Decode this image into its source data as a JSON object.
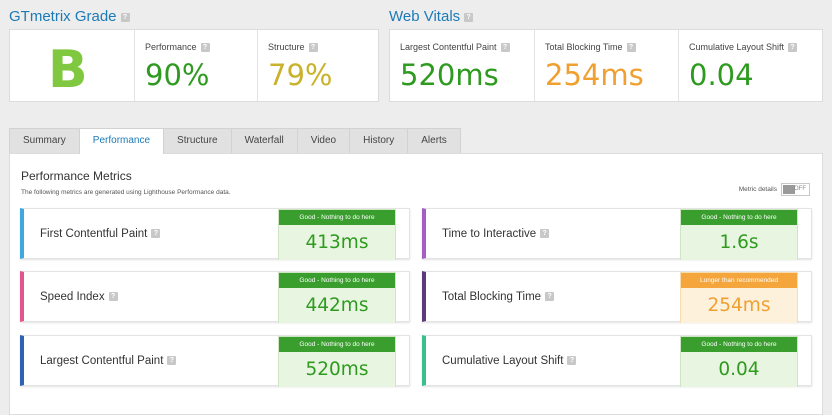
{
  "grade_section": {
    "title": "GTmetrix Grade",
    "grade": "B",
    "performance": {
      "label": "Performance",
      "value": "90%"
    },
    "structure": {
      "label": "Structure",
      "value": "79%"
    }
  },
  "vitals_section": {
    "title": "Web Vitals",
    "lcp": {
      "label": "Largest Contentful Paint",
      "value": "520ms"
    },
    "tbt": {
      "label": "Total Blocking Time",
      "value": "254ms"
    },
    "cls": {
      "label": "Cumulative Layout Shift",
      "value": "0.04"
    }
  },
  "help_glyph": "?",
  "tabs": [
    "Summary",
    "Performance",
    "Structure",
    "Waterfall",
    "Video",
    "History",
    "Alerts"
  ],
  "active_tab": "Performance",
  "panel": {
    "title": "Performance Metrics",
    "subtitle": "The following metrics are generated using Lighthouse Performance data.",
    "metric_details_label": "Metric details",
    "toggle_text": "OFF"
  },
  "metrics": [
    {
      "name": "First Contentful Paint",
      "status": "Good - Nothing to do here",
      "value": "413ms",
      "accent": "#3fa9dd",
      "state": "good"
    },
    {
      "name": "Time to Interactive",
      "status": "Good - Nothing to do here",
      "value": "1.6s",
      "accent": "#a35fc4",
      "state": "good"
    },
    {
      "name": "Speed Index",
      "status": "Good - Nothing to do here",
      "value": "442ms",
      "accent": "#e3558d",
      "state": "good"
    },
    {
      "name": "Total Blocking Time",
      "status": "Longer than recommended",
      "value": "254ms",
      "accent": "#5d3a7a",
      "state": "warn"
    },
    {
      "name": "Largest Contentful Paint",
      "status": "Good - Nothing to do here",
      "value": "520ms",
      "accent": "#2e62b3",
      "state": "good"
    },
    {
      "name": "Cumulative Layout Shift",
      "status": "Good - Nothing to do here",
      "value": "0.04",
      "accent": "#3cbf8f",
      "state": "good"
    }
  ],
  "colors": {
    "good_badge": "#3a9e2e",
    "good_bg": "#e8f6e1",
    "good_text": "#2e9a1f",
    "warn_badge": "#f4a53b",
    "warn_bg": "#fdf1dc",
    "warn_text": "#f0a030",
    "structure_text": "#c9b22c",
    "link": "#1b7ab8"
  }
}
